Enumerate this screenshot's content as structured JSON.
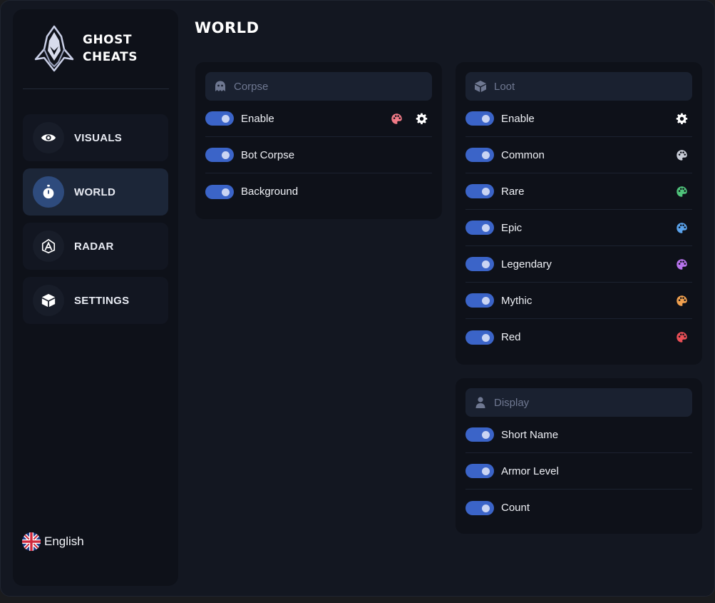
{
  "brand": {
    "line1": "GHOST",
    "line2": "CHEATS"
  },
  "page_title": "WORLD",
  "nav": [
    {
      "label": "VISUALS",
      "icon": "eye-icon",
      "active": false
    },
    {
      "label": "WORLD",
      "icon": "stopwatch-icon",
      "active": true
    },
    {
      "label": "RADAR",
      "icon": "radar-icon",
      "active": false
    },
    {
      "label": "SETTINGS",
      "icon": "box-icon",
      "active": false
    }
  ],
  "language": {
    "label": "English",
    "icon": "uk-flag-icon"
  },
  "corpse": {
    "title": "Corpse",
    "rows": [
      {
        "label": "Enable",
        "on": true,
        "palette_color": "#f07a86",
        "gear": true
      },
      {
        "label": "Bot Corpse",
        "on": true
      },
      {
        "label": "Background",
        "on": true
      }
    ]
  },
  "loot": {
    "title": "Loot",
    "rows": [
      {
        "label": "Enable",
        "on": true,
        "gear": true
      },
      {
        "label": "Common",
        "on": true,
        "palette_color": "#c8ccd6"
      },
      {
        "label": "Rare",
        "on": true,
        "palette_color": "#4fc27a"
      },
      {
        "label": "Epic",
        "on": true,
        "palette_color": "#5aa2ea"
      },
      {
        "label": "Legendary",
        "on": true,
        "palette_color": "#b773ec"
      },
      {
        "label": "Mythic",
        "on": true,
        "palette_color": "#f0a04e"
      },
      {
        "label": "Red",
        "on": true,
        "palette_color": "#ea4f56"
      }
    ]
  },
  "display": {
    "title": "Display",
    "rows": [
      {
        "label": "Short Name",
        "on": true
      },
      {
        "label": "Armor Level",
        "on": true
      },
      {
        "label": "Count",
        "on": true
      }
    ]
  },
  "colors": {
    "accent": "#3b64c8",
    "panel": "#0e1119",
    "active_nav": "#1c2638"
  }
}
